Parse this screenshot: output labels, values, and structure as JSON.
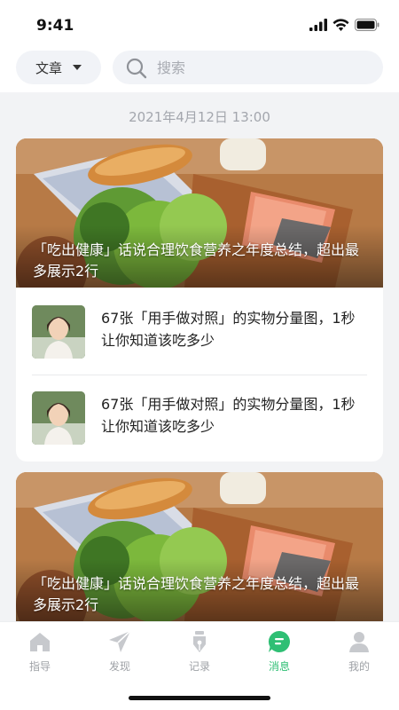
{
  "status_bar": {
    "time": "9:41"
  },
  "top_bar": {
    "category": "文章",
    "search_placeholder": "搜索"
  },
  "feed": {
    "timestamp": "2021年4月12日 13:00",
    "cards": [
      {
        "hero_title": "「吃出健康」话说合理饮食营养之年度总结，超出最多展示2行",
        "items": [
          {
            "title": "67张「用手做对照」的实物分量图，1秒让你知道该吃多少"
          },
          {
            "title": "67张「用手做对照」的实物分量图，1秒让你知道该吃多少"
          }
        ]
      },
      {
        "hero_title": "「吃出健康」话说合理饮食营养之年度总结，超出最多展示2行"
      }
    ]
  },
  "tab_bar": {
    "tabs": [
      {
        "label": "指导",
        "icon": "home-icon",
        "active": false
      },
      {
        "label": "发现",
        "icon": "send-icon",
        "active": false
      },
      {
        "label": "记录",
        "icon": "pen-icon",
        "active": false
      },
      {
        "label": "消息",
        "icon": "message-icon",
        "active": true
      },
      {
        "label": "我的",
        "icon": "user-icon",
        "active": false
      }
    ],
    "active_color": "#2fbf74",
    "inactive_color": "#c7c9cd"
  }
}
